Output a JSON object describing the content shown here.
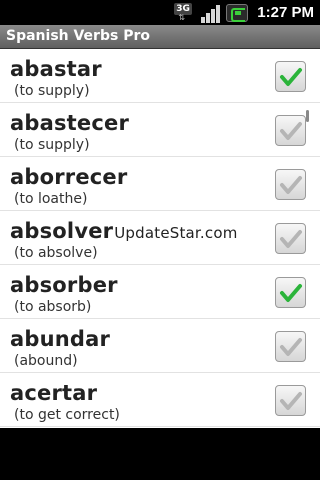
{
  "status": {
    "time": "1:27 PM",
    "network": "3G",
    "icons": [
      "network-3g-icon",
      "signal-icon",
      "battery-icon"
    ]
  },
  "app": {
    "title": "Spanish Verbs Pro"
  },
  "colors": {
    "check_on": "#2bb43a",
    "check_off": "#b5b5b5",
    "title_bar": "#6e6e6e"
  },
  "verbs": [
    {
      "verb": "abastar",
      "translation": "(to supply)",
      "checked": true
    },
    {
      "verb": "abastecer",
      "translation": "(to supply)",
      "checked": false
    },
    {
      "verb": "aborrecer",
      "translation": "(to loathe)",
      "checked": false
    },
    {
      "verb": "absolver",
      "translation": "(to absolve)",
      "checked": false,
      "overlay": "UpdateStar.com"
    },
    {
      "verb": "absorber",
      "translation": "(to absorb)",
      "checked": true
    },
    {
      "verb": "abundar",
      "translation": "(abound)",
      "checked": false
    },
    {
      "verb": "acertar",
      "translation": "(to get correct)",
      "checked": false
    }
  ]
}
